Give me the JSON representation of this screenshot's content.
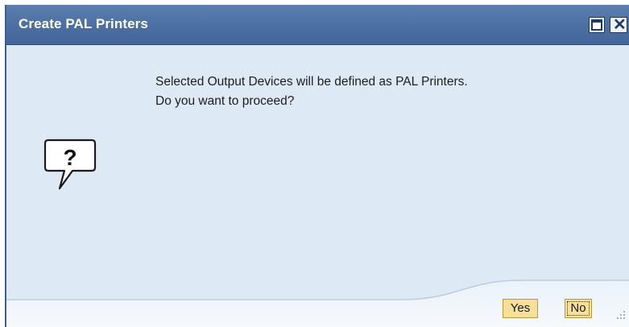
{
  "dialog": {
    "title": "Create PAL Printers",
    "window_buttons": {
      "maximize_icon": "maximize-icon",
      "close_icon": "close-icon",
      "close_glyph": "✕"
    },
    "message_lines": [
      "Selected Output Devices will be defined as PAL Printers.",
      "Do you want to proceed?"
    ],
    "icon": "question-icon",
    "buttons": {
      "yes_label": "Yes",
      "no_label": "No"
    },
    "colors": {
      "titlebar": "#4b6fa1",
      "body": "#dde9f5",
      "button": "#f7e09a"
    }
  }
}
